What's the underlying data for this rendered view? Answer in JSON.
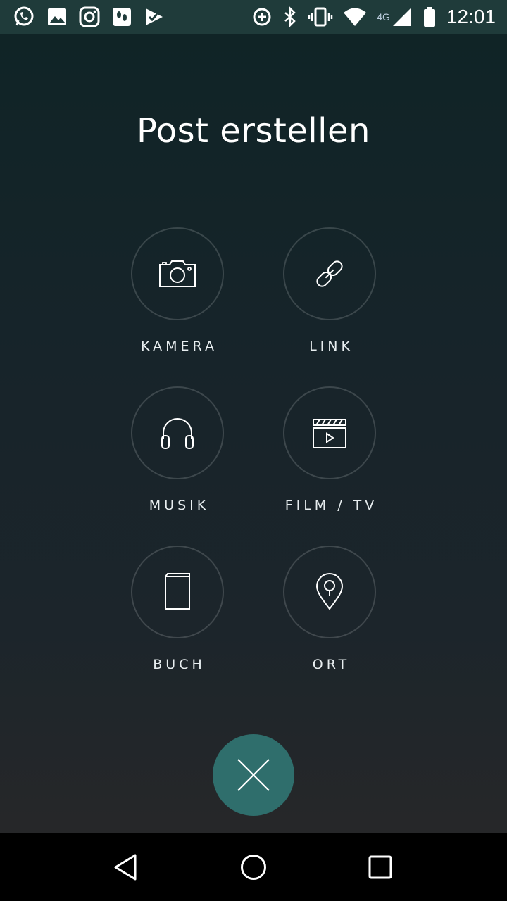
{
  "status_bar": {
    "left_icons": [
      "whatsapp-icon",
      "gallery-icon",
      "instagram-icon",
      "foursquare-icon",
      "check-app-icon"
    ],
    "network_label": "4G",
    "time": "12:01"
  },
  "page": {
    "title": "Post erstellen"
  },
  "options": [
    {
      "id": "kamera",
      "label": "KAMERA",
      "icon": "camera-icon"
    },
    {
      "id": "link",
      "label": "LINK",
      "icon": "link-icon"
    },
    {
      "id": "musik",
      "label": "MUSIK",
      "icon": "headphones-icon"
    },
    {
      "id": "film-tv",
      "label": "FILM / TV",
      "icon": "clapperboard-icon"
    },
    {
      "id": "buch",
      "label": "BUCH",
      "icon": "book-icon"
    },
    {
      "id": "ort",
      "label": "ORT",
      "icon": "location-pin-icon"
    }
  ],
  "close_button": {
    "icon": "close-icon",
    "color": "#2f6e6c"
  },
  "nav_bar": {
    "icons": [
      "back-icon",
      "home-icon",
      "recents-icon"
    ]
  }
}
